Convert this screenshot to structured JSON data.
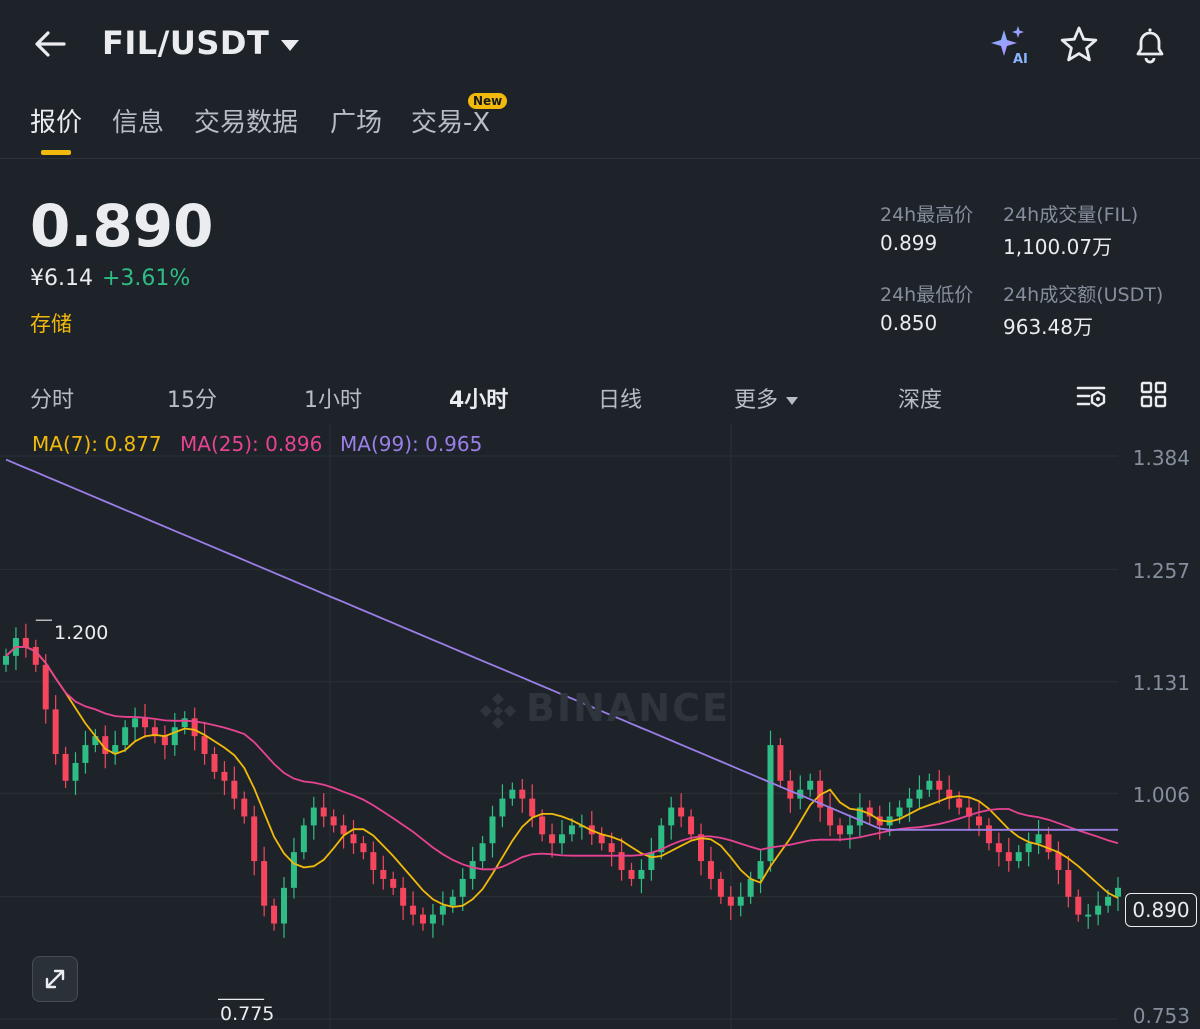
{
  "header": {
    "pair": "FIL/USDT",
    "icons": [
      "back-arrow-icon",
      "ai-sparkle-icon",
      "star-icon",
      "bell-icon"
    ],
    "ai_label": "AI"
  },
  "tabs": [
    {
      "label": "报价",
      "active": true
    },
    {
      "label": "信息"
    },
    {
      "label": "交易数据"
    },
    {
      "label": "广场"
    },
    {
      "label": "交易-X",
      "badge": "New"
    }
  ],
  "ticker": {
    "last_price": "0.890",
    "cny_price": "¥6.14",
    "change": "+3.61%",
    "tag": "存储",
    "stats": [
      {
        "label": "24h最高价",
        "value": "0.899"
      },
      {
        "label": "24h成交量(FIL)",
        "value": "1,100.07万"
      },
      {
        "label": "24h最低价",
        "value": "0.850"
      },
      {
        "label": "24h成交额(USDT)",
        "value": "963.48万"
      }
    ]
  },
  "intervals": [
    {
      "label": "分时"
    },
    {
      "label": "15分"
    },
    {
      "label": "1小时"
    },
    {
      "label": "4小时",
      "active": true
    },
    {
      "label": "日线"
    },
    {
      "label": "更多",
      "dropdown": true
    },
    {
      "label": "深度"
    }
  ],
  "chart_data": {
    "type": "candlestick",
    "interval": "4小时",
    "watermark": "BINANCE",
    "indicators": [
      {
        "name": "MA(7)",
        "label": "MA(7): 0.877",
        "value": 0.877,
        "color": "#f0b90b"
      },
      {
        "name": "MA(25)",
        "label": "MA(25): 0.896",
        "value": 0.896,
        "color": "#e84393"
      },
      {
        "name": "MA(99)",
        "label": "MA(99): 0.965",
        "value": 0.965,
        "color": "#9b7fe8"
      }
    ],
    "y_ticks": [
      "1.384",
      "1.257",
      "1.131",
      "1.006",
      "0.890",
      "0.753"
    ],
    "ylim": [
      0.753,
      1.384
    ],
    "last_price_label": "0.890",
    "high_marker": {
      "label": "1.200",
      "value": 1.2
    },
    "low_marker": {
      "label": "0.775",
      "value": 0.775
    },
    "close": [
      1.16,
      1.18,
      1.17,
      1.15,
      1.1,
      1.05,
      1.02,
      1.04,
      1.06,
      1.07,
      1.05,
      1.06,
      1.08,
      1.09,
      1.08,
      1.07,
      1.06,
      1.08,
      1.09,
      1.07,
      1.05,
      1.03,
      1.02,
      1.0,
      0.98,
      0.93,
      0.88,
      0.86,
      0.9,
      0.94,
      0.97,
      0.99,
      0.98,
      0.97,
      0.96,
      0.95,
      0.94,
      0.92,
      0.91,
      0.9,
      0.88,
      0.87,
      0.86,
      0.87,
      0.88,
      0.89,
      0.91,
      0.93,
      0.95,
      0.98,
      1.0,
      1.01,
      1.0,
      0.98,
      0.96,
      0.95,
      0.96,
      0.97,
      0.97,
      0.96,
      0.95,
      0.94,
      0.92,
      0.91,
      0.92,
      0.94,
      0.97,
      0.99,
      0.98,
      0.96,
      0.93,
      0.91,
      0.89,
      0.88,
      0.89,
      0.91,
      0.93,
      1.06,
      1.02,
      1.0,
      1.01,
      1.02,
      0.99,
      0.97,
      0.96,
      0.97,
      0.99,
      0.98,
      0.97,
      0.98,
      0.99,
      1.0,
      1.01,
      1.02,
      1.01,
      1.0,
      0.99,
      0.98,
      0.97,
      0.95,
      0.94,
      0.93,
      0.94,
      0.95,
      0.96,
      0.94,
      0.92,
      0.89,
      0.87,
      0.87,
      0.88,
      0.89,
      0.9
    ]
  }
}
